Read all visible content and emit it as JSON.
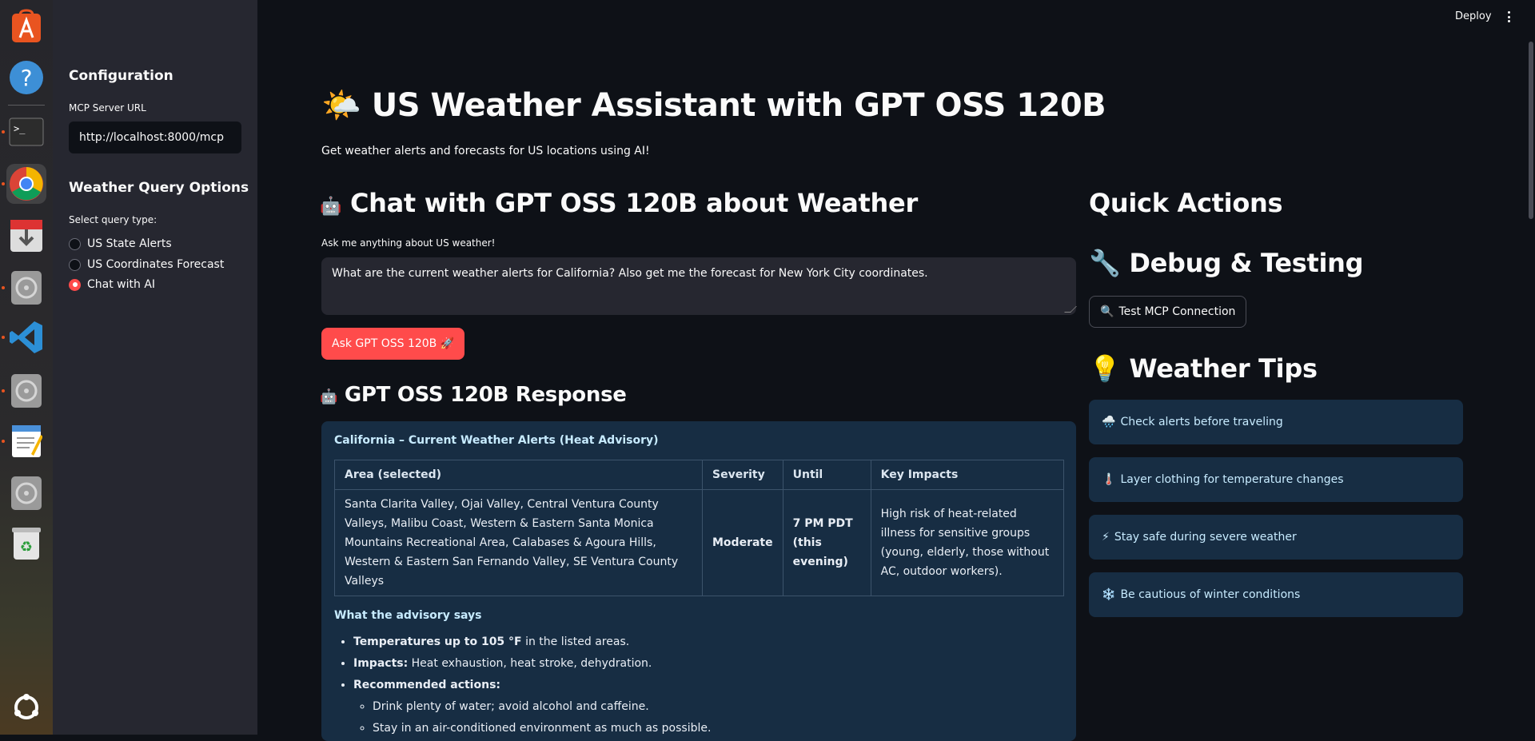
{
  "header": {
    "deploy_label": "Deploy"
  },
  "sidebar": {
    "config_title": "Configuration",
    "mcp_label": "MCP Server URL",
    "mcp_value": "http://localhost:8000/mcp",
    "options_title": "Weather Query Options",
    "query_type_label": "Select query type:",
    "options": [
      {
        "label": "US State Alerts",
        "selected": false
      },
      {
        "label": "US Coordinates Forecast",
        "selected": false
      },
      {
        "label": "Chat with AI",
        "selected": true
      }
    ]
  },
  "main": {
    "title_emoji": "🌤️",
    "title": "US Weather Assistant with GPT OSS 120B",
    "subtitle": "Get weather alerts and forecasts for US locations using AI!",
    "chat_emoji": "🤖",
    "chat_title": "Chat with GPT OSS 120B about Weather",
    "ask_label": "Ask me anything about US weather!",
    "question": "What are the current weather alerts for California? Also get me the forecast for New York City coordinates.",
    "ask_button": "Ask GPT OSS 120B 🚀",
    "response_emoji": "🤖",
    "response_title": "GPT OSS 120B Response",
    "response": {
      "heading": "California – Current Weather Alerts (Heat Advisory)",
      "columns": [
        "Area (selected)",
        "Severity",
        "Until",
        "Key Impacts"
      ],
      "row": {
        "area": "Santa Clarita Valley, Ojai Valley, Central Ventura County Valleys, Malibu Coast, Western & Eastern Santa Monica Mountains Recreational Area, Calabases & Agoura Hills, Western & Eastern San Fernando Valley, SE Ventura County Valleys",
        "severity": "Moderate",
        "until": "7 PM PDT (this evening)",
        "impacts": "High risk of heat-related illness for sensitive groups (young, elderly, those without AC, outdoor workers)."
      },
      "advisory_heading": "What the advisory says",
      "bullets": [
        {
          "bold": "Temperatures up to 105 °F",
          "text": " in the listed areas."
        },
        {
          "bold": "Impacts:",
          "text": " Heat exhaustion, heat stroke, dehydration."
        },
        {
          "bold": "Recommended actions:",
          "text": ""
        }
      ],
      "sub_bullets": [
        "Drink plenty of water; avoid alcohol and caffeine.",
        "Stay in an air-conditioned environment as much as possible."
      ]
    }
  },
  "right": {
    "quick_actions_title": "Quick Actions",
    "debug_emoji": "🔧",
    "debug_title": "Debug & Testing",
    "test_button_icon": "🔍",
    "test_button": "Test MCP Connection",
    "tips_emoji": "💡",
    "tips_title": "Weather Tips",
    "tips": [
      {
        "icon": "🌧️",
        "text": "Check alerts before traveling"
      },
      {
        "icon": "🌡️",
        "text": "Layer clothing for temperature changes"
      },
      {
        "icon": "⚡",
        "text": "Stay safe during severe weather"
      },
      {
        "icon": "❄️",
        "text": "Be cautious of winter conditions"
      }
    ]
  },
  "colors": {
    "primary": "#ff4b4b",
    "background": "#0e1117",
    "sidebar": "#262730",
    "info_box": "#172d43"
  }
}
